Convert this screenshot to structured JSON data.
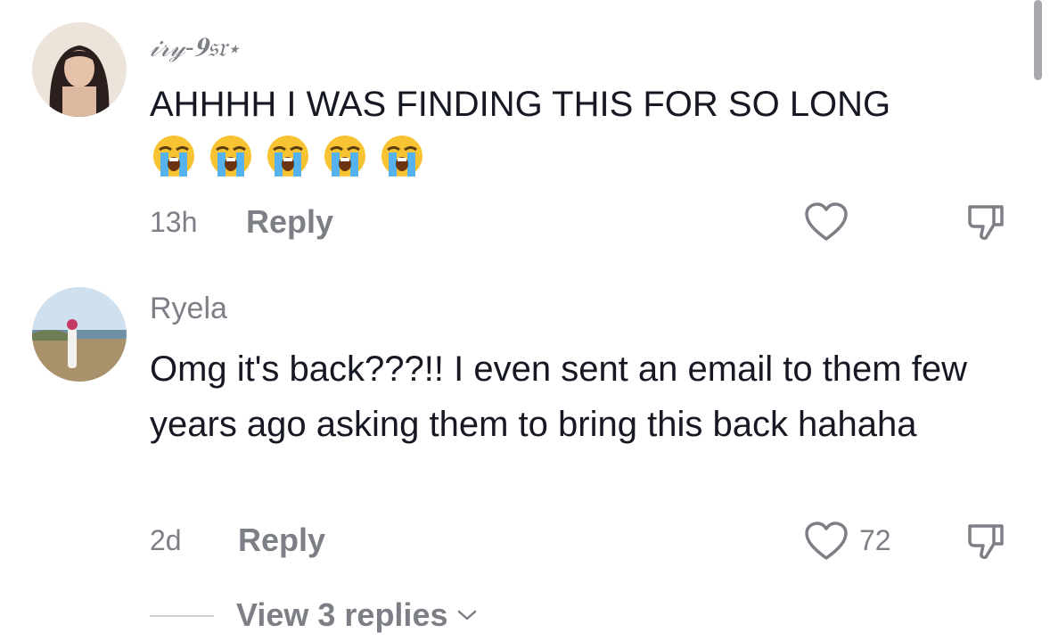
{
  "comments": [
    {
      "username": "𝒾𝓇𝓎-𝟗𝔰𝔯⋆",
      "text": "AHHHH I WAS FINDING THIS FOR SO LONG",
      "emojis": [
        "loudly-crying-face",
        "loudly-crying-face",
        "loudly-crying-face",
        "loudly-crying-face",
        "loudly-crying-face"
      ],
      "time": "13h",
      "reply_label": "Reply",
      "like_count": ""
    },
    {
      "username": "Ryela",
      "text": "Omg it's back???!! I even sent an email to them few years ago asking them to bring this back hahaha",
      "time": "2d",
      "reply_label": "Reply",
      "like_count": "72"
    }
  ],
  "view_replies_label": "View 3 replies",
  "colors": {
    "text": "#161823",
    "muted": "#7d7f86"
  },
  "icons": [
    "heart-icon",
    "dislike-icon",
    "chevron-down-icon"
  ]
}
